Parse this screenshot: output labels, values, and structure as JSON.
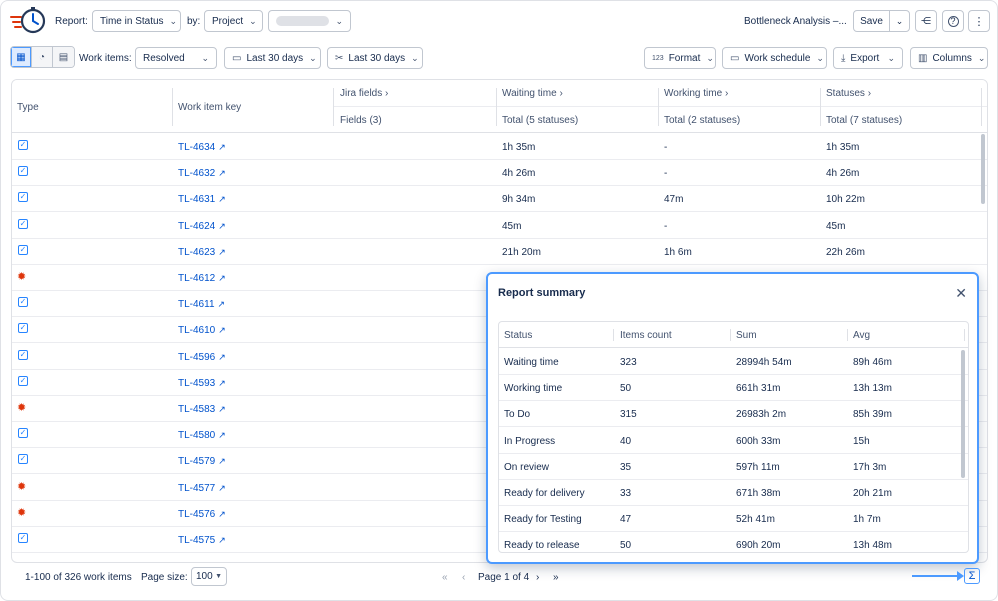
{
  "header": {
    "report_label": "Report:",
    "report_type": "Time in Status",
    "by_label": "by:",
    "group_by": "Project",
    "report_name": "Bottleneck Analysis –...",
    "save_label": "Save"
  },
  "toolbar": {
    "work_items_label": "Work items:",
    "work_items_filter": "Resolved",
    "date_range_1": "Last 30 days",
    "date_range_2": "Last 30 days",
    "format_label": "Format",
    "format_icon_text": "123",
    "work_schedule_label": "Work schedule",
    "export_label": "Export",
    "columns_label": "Columns"
  },
  "table": {
    "col_type": "Type",
    "col_key": "Work item key",
    "groups": [
      {
        "title": "Jira fields",
        "sub": "Fields (3)"
      },
      {
        "title": "Waiting time",
        "sub": "Total (5 statuses)"
      },
      {
        "title": "Working time",
        "sub": "Total (2 statuses)"
      },
      {
        "title": "Statuses",
        "sub": "Total (7 statuses)"
      }
    ],
    "rows": [
      {
        "type": "task",
        "key": "TL-4634",
        "waiting": "1h 35m",
        "working": "-",
        "statuses": "1h 35m"
      },
      {
        "type": "task",
        "key": "TL-4632",
        "waiting": "4h 26m",
        "working": "-",
        "statuses": "4h 26m"
      },
      {
        "type": "task",
        "key": "TL-4631",
        "waiting": "9h 34m",
        "working": "47m",
        "statuses": "10h 22m"
      },
      {
        "type": "task",
        "key": "TL-4624",
        "waiting": "45m",
        "working": "-",
        "statuses": "45m"
      },
      {
        "type": "task",
        "key": "TL-4623",
        "waiting": "21h 20m",
        "working": "1h 6m",
        "statuses": "22h 26m"
      },
      {
        "type": "bug",
        "key": "TL-4612",
        "waiting": "",
        "working": "",
        "statuses": ""
      },
      {
        "type": "task",
        "key": "TL-4611",
        "waiting": "",
        "working": "",
        "statuses": ""
      },
      {
        "type": "task",
        "key": "TL-4610",
        "waiting": "",
        "working": "",
        "statuses": ""
      },
      {
        "type": "task",
        "key": "TL-4596",
        "waiting": "",
        "working": "",
        "statuses": ""
      },
      {
        "type": "task",
        "key": "TL-4593",
        "waiting": "",
        "working": "",
        "statuses": ""
      },
      {
        "type": "bug",
        "key": "TL-4583",
        "waiting": "",
        "working": "",
        "statuses": ""
      },
      {
        "type": "task",
        "key": "TL-4580",
        "waiting": "",
        "working": "",
        "statuses": ""
      },
      {
        "type": "task",
        "key": "TL-4579",
        "waiting": "",
        "working": "",
        "statuses": ""
      },
      {
        "type": "bug",
        "key": "TL-4577",
        "waiting": "",
        "working": "",
        "statuses": ""
      },
      {
        "type": "bug",
        "key": "TL-4576",
        "waiting": "",
        "working": "",
        "statuses": ""
      },
      {
        "type": "task",
        "key": "TL-4575",
        "waiting": "",
        "working": "",
        "statuses": ""
      }
    ]
  },
  "footer": {
    "range_text": "1-100 of 326 work items",
    "page_size_label": "Page size:",
    "page_size_value": "100",
    "page_text": "Page 1 of 4"
  },
  "summary": {
    "title": "Report summary",
    "columns": [
      "Status",
      "Items count",
      "Sum",
      "Avg"
    ],
    "rows": [
      {
        "status": "Waiting time",
        "count": "323",
        "sum": "28994h 54m",
        "avg": "89h 46m"
      },
      {
        "status": "Working time",
        "count": "50",
        "sum": "661h 31m",
        "avg": "13h 13m"
      },
      {
        "status": "To Do",
        "count": "315",
        "sum": "26983h 2m",
        "avg": "85h 39m"
      },
      {
        "status": "In Progress",
        "count": "40",
        "sum": "600h 33m",
        "avg": "15h"
      },
      {
        "status": "On review",
        "count": "35",
        "sum": "597h 11m",
        "avg": "17h 3m"
      },
      {
        "status": "Ready for delivery",
        "count": "33",
        "sum": "671h 38m",
        "avg": "20h 21m"
      },
      {
        "status": "Ready for Testing",
        "count": "47",
        "sum": "52h 41m",
        "avg": "1h 7m"
      },
      {
        "status": "Ready to release",
        "count": "50",
        "sum": "690h 20m",
        "avg": "13h 48m"
      }
    ]
  },
  "colors": {
    "accent": "#0052cc",
    "highlight": "#4c9aff",
    "bug": "#de350b"
  }
}
